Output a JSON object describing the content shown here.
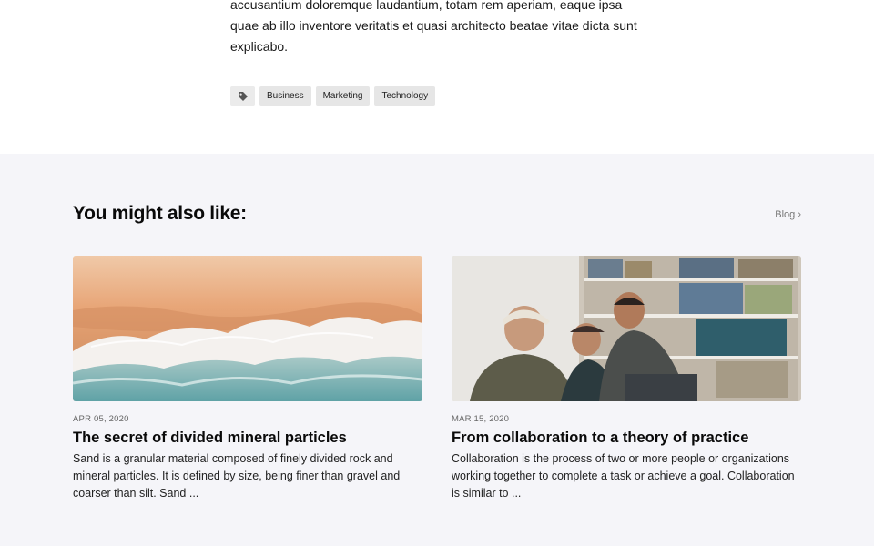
{
  "article": {
    "body": "accusantium doloremque laudantium, totam rem aperiam, eaque ipsa quae ab illo inventore veritatis et quasi architecto beatae vitae dicta sunt explicabo.",
    "tags": [
      "Business",
      "Marketing",
      "Technology"
    ],
    "tag_icon": "tag-icon"
  },
  "related": {
    "heading": "You might also like:",
    "blog_link": "Blog ›",
    "cards": [
      {
        "date": "APR 05, 2020",
        "title": "The secret of divided mineral particles",
        "excerpt": "Sand is a granular material composed of finely divided rock and mineral particles. It is defined by size, being finer than gravel and coarser than silt. Sand ..."
      },
      {
        "date": "MAR 15, 2020",
        "title": "From collaboration to a theory of practice",
        "excerpt": "Collaboration is the process of two or more people or organizations working together to complete a task or achieve a goal. Collaboration is similar to ..."
      }
    ]
  },
  "colors": {
    "section_bg": "#f5f5f9",
    "tag_bg": "#e6e6e6"
  }
}
